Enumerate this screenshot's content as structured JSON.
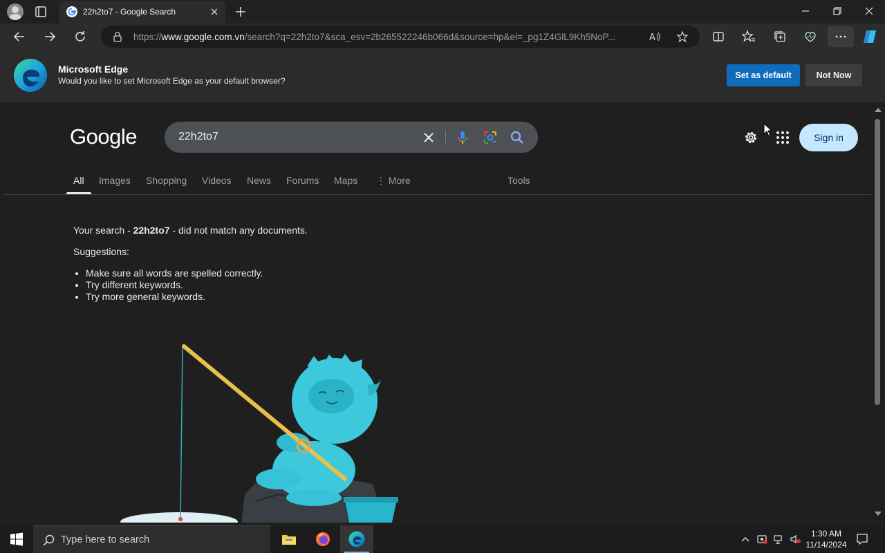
{
  "browser": {
    "tab": {
      "title": "22h2to7 - Google Search"
    },
    "url_prefix": "https://",
    "url_domain": "www.google.com.vn",
    "url_rest": "/search?q=22h2to7&sca_esv=2b265522246b066d&source=hp&ei=_pg1Z4GlL9Kh5NoP..."
  },
  "banner": {
    "title": "Microsoft Edge",
    "subtitle": "Would you like to set Microsoft Edge as your default browser?",
    "set_default_label": "Set as default",
    "not_now_label": "Not Now"
  },
  "google": {
    "logo_text": "Google",
    "query": "22h2to7",
    "sign_in_label": "Sign in",
    "tabs": [
      {
        "label": "All",
        "active": true
      },
      {
        "label": "Images"
      },
      {
        "label": "Shopping"
      },
      {
        "label": "Videos"
      },
      {
        "label": "News"
      },
      {
        "label": "Forums"
      },
      {
        "label": "Maps"
      },
      {
        "label": "More"
      }
    ],
    "tools_label": "Tools",
    "no_results": {
      "prefix": "Your search - ",
      "query": "22h2to7",
      "suffix": " - did not match any documents.",
      "suggestions_heading": "Suggestions:",
      "suggestions": [
        "Make sure all words are spelled correctly.",
        "Try different keywords.",
        "Try more general keywords."
      ]
    }
  },
  "taskbar": {
    "search_placeholder": "Type here to search",
    "time": "1:30 AM",
    "date": "11/14/2024"
  },
  "colors": {
    "accent_blue": "#0f6cbd",
    "signin_bg": "#c2e7ff",
    "page_bg": "#1f1f1f",
    "yeti": "#3ec8dc"
  }
}
